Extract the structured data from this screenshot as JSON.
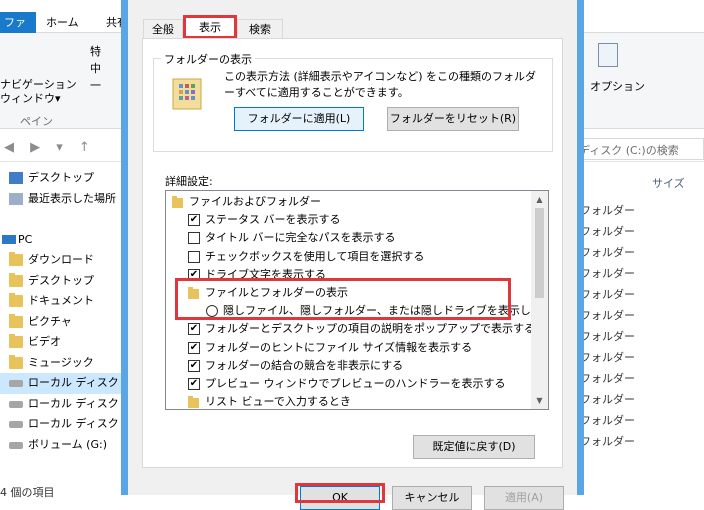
{
  "explorer": {
    "ribbon_tabs": [
      "ファイル",
      "ホーム",
      "共有"
    ],
    "ribbon": {
      "navpane_label": "ナビゲーション\nウィンドウ▾",
      "group_label": "ペイン",
      "small_items": [
        "特",
        "中",
        "一"
      ],
      "options_label": "オプション"
    },
    "search_placeholder": "ディスク (C:)の検索",
    "column_size": "サイズ",
    "folder_type_label": "フォルダー",
    "nav_tree": [
      {
        "label": "デスクトップ",
        "icon": "desktop-icon",
        "level": 1
      },
      {
        "label": "最近表示した場所",
        "icon": "recent-places-icon",
        "level": 1
      },
      {
        "label": "",
        "icon": "",
        "level": 1
      },
      {
        "label": "PC",
        "icon": "pc-icon",
        "level": 0
      },
      {
        "label": "ダウンロード",
        "icon": "folder-icon",
        "level": 1
      },
      {
        "label": "デスクトップ",
        "icon": "folder-icon",
        "level": 1
      },
      {
        "label": "ドキュメント",
        "icon": "folder-icon",
        "level": 1
      },
      {
        "label": "ピクチャ",
        "icon": "folder-icon",
        "level": 1
      },
      {
        "label": "ビデオ",
        "icon": "folder-icon",
        "level": 1
      },
      {
        "label": "ミュージック",
        "icon": "folder-icon",
        "level": 1
      },
      {
        "label": "ローカル ディスク (C",
        "icon": "drive-icon",
        "level": 1,
        "selected": true
      },
      {
        "label": "ローカル ディスク (E",
        "icon": "drive-icon",
        "level": 1
      },
      {
        "label": "ローカル ディスク (F",
        "icon": "drive-icon",
        "level": 1
      },
      {
        "label": "ボリューム (G:)",
        "icon": "drive-icon",
        "level": 1
      }
    ],
    "status": "4 個の項目"
  },
  "dialog": {
    "tabs": [
      "全般",
      "表示",
      "検索"
    ],
    "active_tab": "表示",
    "folder_view": {
      "title": "フォルダーの表示",
      "description": "この表示方法 (詳細表示やアイコンなど) をこの種類のフォルダーすべてに適用することができます。",
      "apply_button": "フォルダーに適用(L)",
      "reset_button": "フォルダーをリセット(R)"
    },
    "advanced_label": "詳細設定:",
    "settings": [
      {
        "type": "folder",
        "label": "ファイルおよびフォルダー",
        "indent": 0
      },
      {
        "type": "check",
        "checked": true,
        "label": "ステータス バーを表示する",
        "indent": 1
      },
      {
        "type": "check",
        "checked": false,
        "label": "タイトル バーに完全なパスを表示する",
        "indent": 1
      },
      {
        "type": "check",
        "checked": false,
        "label": "チェックボックスを使用して項目を選択する",
        "indent": 1
      },
      {
        "type": "check",
        "checked": true,
        "label": "ドライブ文字を表示する",
        "indent": 1
      },
      {
        "type": "folder",
        "label": "ファイルとフォルダーの表示",
        "indent": 1
      },
      {
        "type": "radio",
        "checked": false,
        "label": "隠しファイル、隠しフォルダー、または隠しドライブを表示しない",
        "indent": 2
      },
      {
        "type": "check",
        "checked": true,
        "label": "フォルダーとデスクトップの項目の説明をポップアップで表示する",
        "indent": 1
      },
      {
        "type": "check",
        "checked": true,
        "label": "フォルダーのヒントにファイル サイズ情報を表示する",
        "indent": 1
      },
      {
        "type": "check",
        "checked": true,
        "label": "フォルダーの結合の競合を非表示にする",
        "indent": 1
      },
      {
        "type": "check",
        "checked": true,
        "label": "プレビュー ウィンドウでプレビューのハンドラーを表示する",
        "indent": 1
      },
      {
        "type": "folder",
        "label": "リスト ビューで入力するとき",
        "indent": 1
      }
    ],
    "restore_button": "既定値に戻す(D)",
    "ok_button": "OK",
    "cancel_button": "キャンセル",
    "apply_button": "適用(A)"
  },
  "colors": {
    "highlight": "#e0373c",
    "dialog_border": "#5aa5e4",
    "accent": "#1979ca"
  }
}
